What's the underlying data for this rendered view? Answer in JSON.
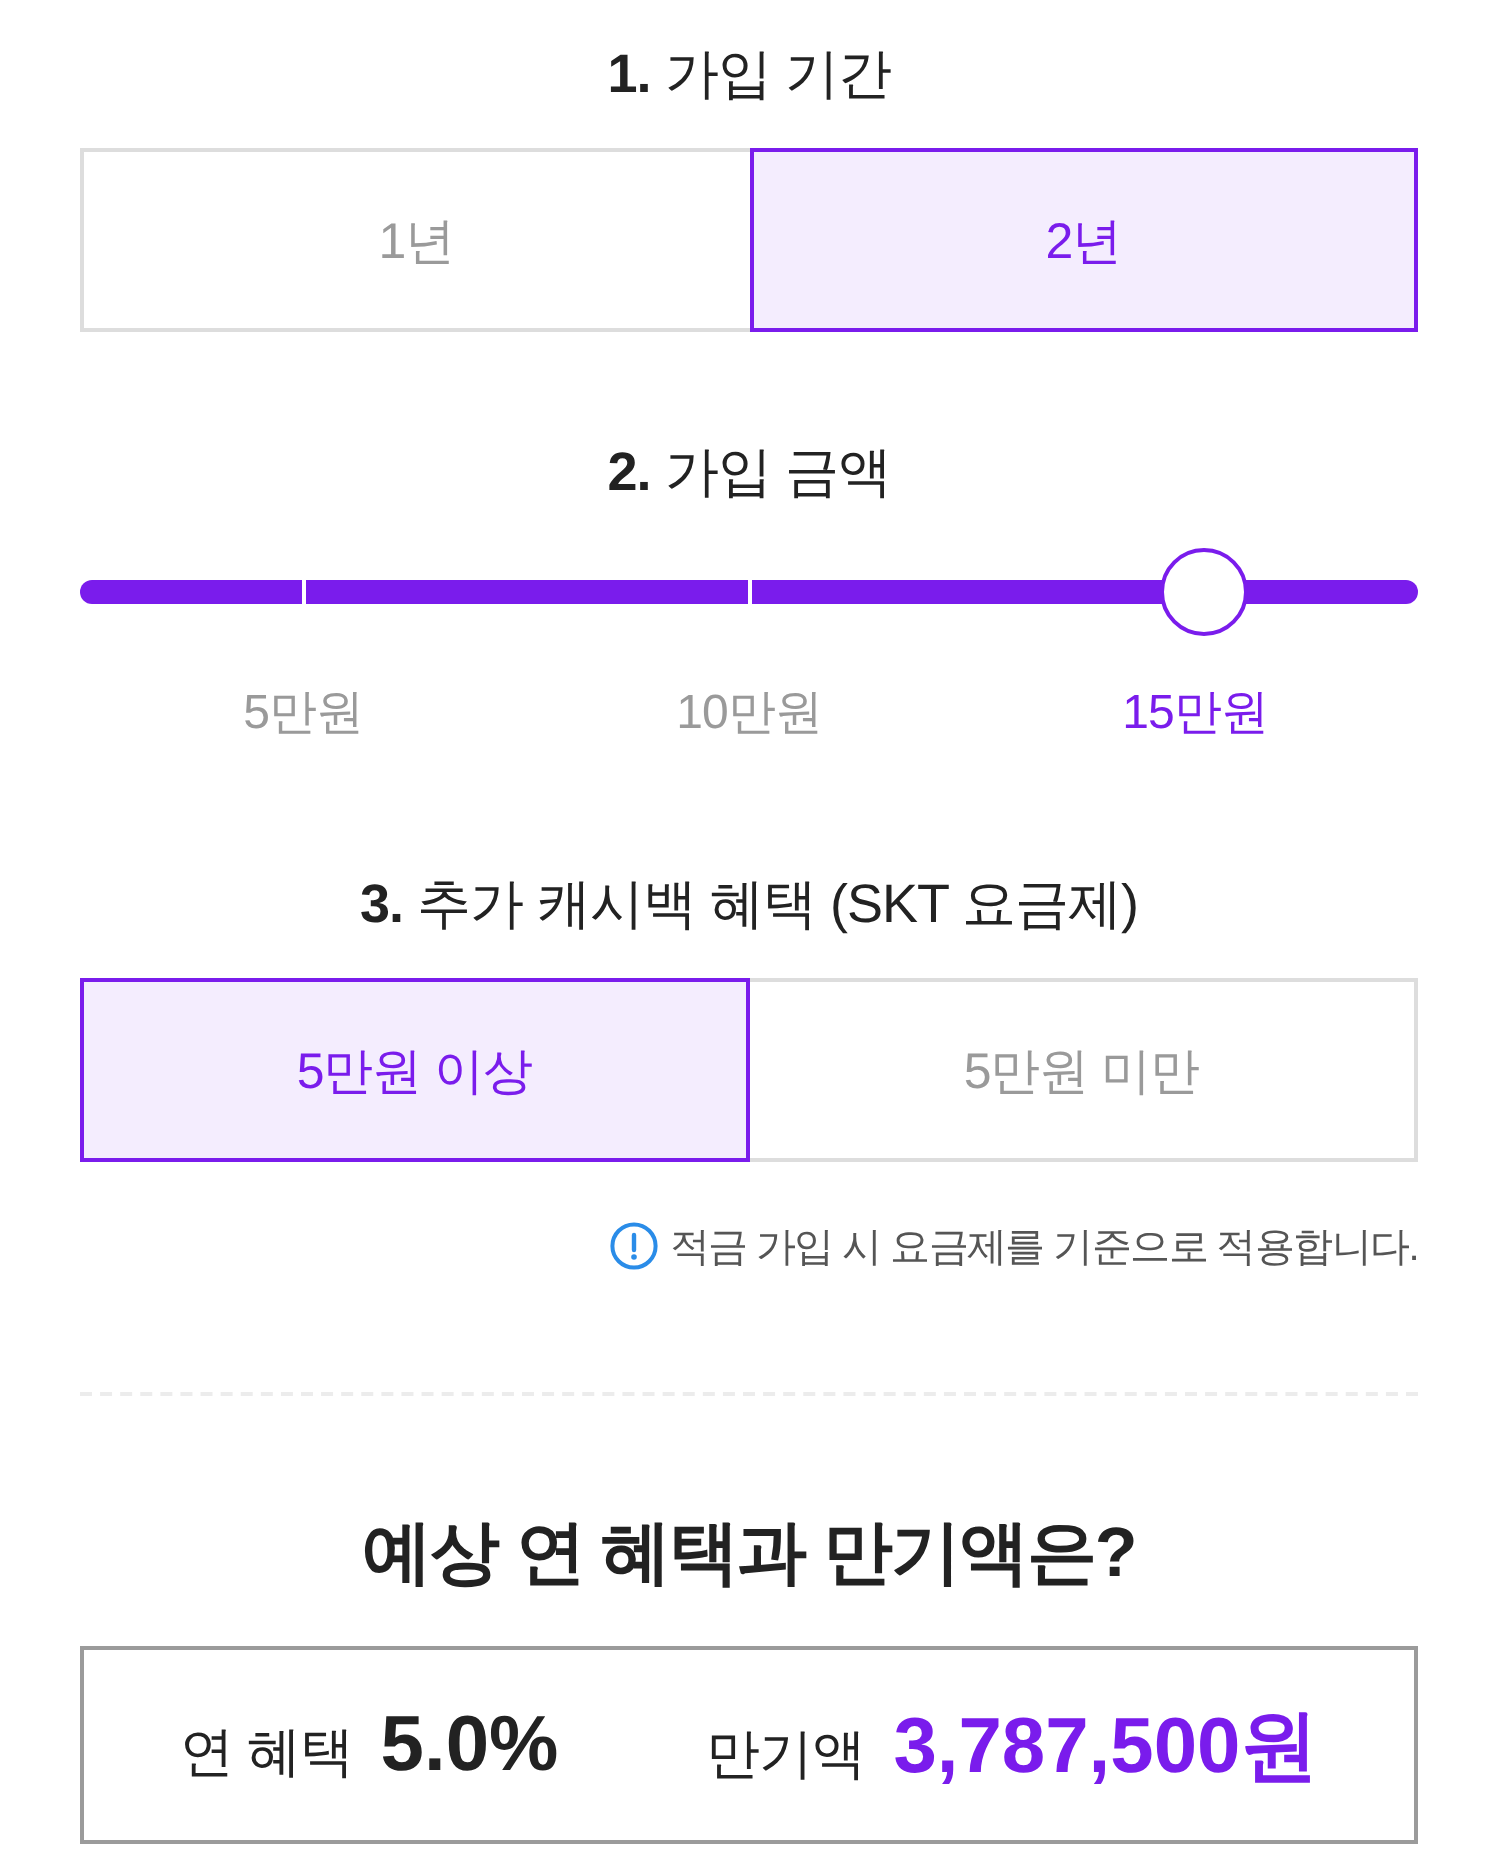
{
  "sections": [
    {
      "kind": "segments",
      "title": "**1.** 가입 기간",
      "options": [
        {
          "label": "1년",
          "selected": false
        },
        {
          "label": "2년",
          "selected": true
        }
      ]
    },
    {
      "kind": "slider",
      "title": "**2.** 가입 금액",
      "level": 0.84,
      "options": [
        {
          "label": "5만원",
          "selected": false
        },
        {
          "label": "10만원",
          "selected": false
        },
        {
          "label": "15만원",
          "selected": true
        }
      ]
    },
    {
      "kind": "segments",
      "title": "**3.** 추가 캐시백 혜택 (SKT 요금제)",
      "options": [
        {
          "label": "5만원 이상",
          "selected": true
        },
        {
          "label": "5만원 미만",
          "selected": false
        }
      ],
      "notice": "적금 가입 시 요금제를 기준으로 적용합니다."
    }
  ],
  "result": {
    "title": "예상 연 혜택과 만기액은?",
    "items": [
      {
        "kind": "plain",
        "label": "연 혜택",
        "value": "5.0%"
      },
      {
        "kind": "accent",
        "label": "만기액",
        "value": "3,787,500원"
      }
    ]
  }
}
